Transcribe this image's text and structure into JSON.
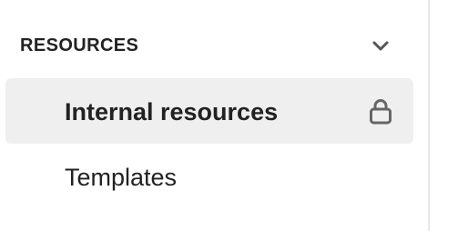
{
  "sidebar": {
    "section": {
      "title": "RESOURCES",
      "collapse_icon": "chevron-down-icon"
    },
    "items": [
      {
        "label": "Internal resources",
        "active": true,
        "icon": "lock-icon"
      },
      {
        "label": "Templates",
        "active": false
      }
    ]
  },
  "colors": {
    "active_bg": "#efefef",
    "text": "#222222",
    "icon": "#666666",
    "divider": "#e6e6e6"
  }
}
